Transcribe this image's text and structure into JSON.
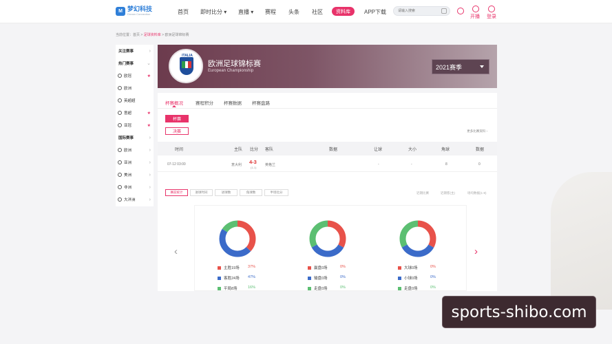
{
  "nav": {
    "logo_text": "梦幻科技",
    "logo_sub": "Dream Connection",
    "items": [
      "首页",
      "即时比分 ▾",
      "直播 ▾",
      "赛程",
      "头条",
      "社区",
      "资料库",
      "APP下载"
    ],
    "search_placeholder": "请输入搜索",
    "live_label": "开播",
    "login_label": "登录"
  },
  "breadcrumb": {
    "prefix": "当前位置：",
    "home": "首页",
    "sep1": " > ",
    "lib": "足球资料库",
    "sep2": " > ",
    "current": "欧洲足球锦标赛"
  },
  "sidebar": {
    "items": [
      {
        "label": "关注赛事",
        "type": "head",
        "arrow": "›"
      },
      {
        "label": "热门赛事",
        "type": "head",
        "arrow": "⌄"
      },
      {
        "label": "欧冠",
        "type": "item",
        "star": "★"
      },
      {
        "label": "欧洲",
        "type": "item"
      },
      {
        "label": "英超超",
        "type": "item"
      },
      {
        "label": "意超",
        "type": "item",
        "star": "★"
      },
      {
        "label": "亚冠",
        "type": "item",
        "star": "★"
      },
      {
        "label": "国际赛事",
        "type": "head",
        "arrow": "›"
      },
      {
        "label": "欧洲",
        "type": "item",
        "arrow": "›"
      },
      {
        "label": "亚洲",
        "type": "item",
        "arrow": "›"
      },
      {
        "label": "美洲",
        "type": "item",
        "arrow": "›"
      },
      {
        "label": "非洲",
        "type": "item",
        "arrow": "›"
      },
      {
        "label": "大洋洲",
        "type": "item",
        "arrow": "›"
      }
    ]
  },
  "banner": {
    "badge_text": "ITALIA",
    "title": "欧洲足球锦标赛",
    "subtitle": "European Championship",
    "season": "2021赛季"
  },
  "tabs": [
    "杯赛概况",
    "赛程积分",
    "杯赛数据",
    "杯赛盘路"
  ],
  "buttons": {
    "final_stage": "杯赛",
    "final": "决赛"
  },
  "more_link": "更多比赛资料 ›",
  "table": {
    "headers": [
      "时间",
      "主队",
      "比分",
      "客队",
      "数据",
      "让球",
      "大小",
      "角球",
      "数据"
    ],
    "row": {
      "time": "07-12 03:00",
      "home": "意大利",
      "score": "4-3",
      "score_sub": "(1-1)",
      "away": "英格兰",
      "handicap": "-",
      "over_under": "-",
      "corners": "8",
      "data": "0"
    }
  },
  "filters": [
    "赛前统计",
    "进球时间",
    "进球数",
    "角球数",
    "半场比分"
  ],
  "stat_links": [
    "近期比赛",
    "近期客(主)",
    "场均数据(1-8)"
  ],
  "donuts": [
    {
      "legend": [
        {
          "label": "主胜19场",
          "pct": "37%",
          "color": "#e8524a"
        },
        {
          "label": "客胜24场",
          "pct": "47%",
          "color": "#3b6bc9"
        },
        {
          "label": "平局8场",
          "pct": "16%",
          "color": "#5cbf72"
        }
      ],
      "values": [
        37,
        47,
        16
      ]
    },
    {
      "legend": [
        {
          "label": "赢盘0场",
          "pct": "0%",
          "color": "#e8524a"
        },
        {
          "label": "输盘0场",
          "pct": "0%",
          "color": "#3b6bc9"
        },
        {
          "label": "走盘0场",
          "pct": "0%",
          "color": "#5cbf72"
        }
      ],
      "values": [
        33,
        34,
        33
      ]
    },
    {
      "legend": [
        {
          "label": "大球0场",
          "pct": "0%",
          "color": "#e8524a"
        },
        {
          "label": "小球0场",
          "pct": "0%",
          "color": "#3b6bc9"
        },
        {
          "label": "走盘0场",
          "pct": "0%",
          "color": "#5cbf72"
        }
      ],
      "values": [
        33,
        34,
        33
      ]
    }
  ],
  "carousel": {
    "prev": "‹",
    "next": "›"
  },
  "watermark": "sports-shibo.com",
  "colors": {
    "accent": "#e8336a",
    "red": "#e8524a",
    "blue": "#3b6bc9",
    "green": "#5cbf72"
  }
}
